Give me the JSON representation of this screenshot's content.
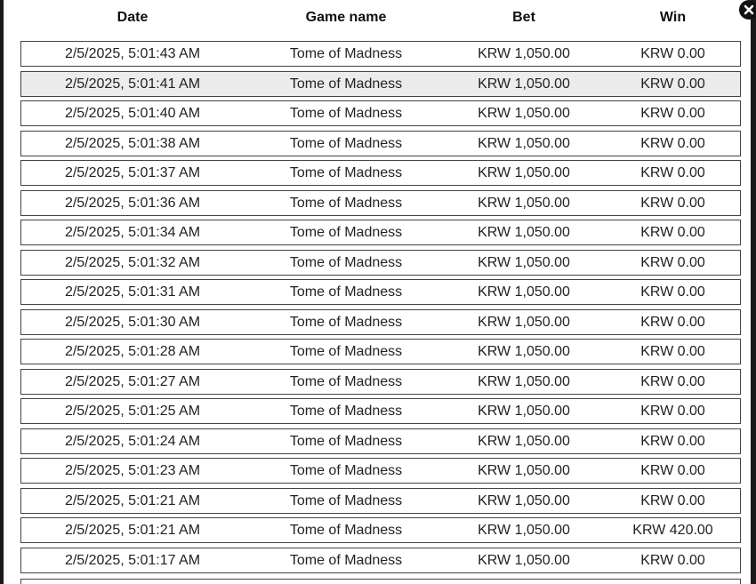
{
  "table": {
    "headers": {
      "date": "Date",
      "game": "Game name",
      "bet": "Bet",
      "win": "Win"
    },
    "rows": [
      {
        "date": "2/5/2025, 5:01:43 AM",
        "game": "Tome of Madness",
        "bet": "KRW 1,050.00",
        "win": "KRW 0.00"
      },
      {
        "date": "2/5/2025, 5:01:41 AM",
        "game": "Tome of Madness",
        "bet": "KRW 1,050.00",
        "win": "KRW 0.00"
      },
      {
        "date": "2/5/2025, 5:01:40 AM",
        "game": "Tome of Madness",
        "bet": "KRW 1,050.00",
        "win": "KRW 0.00"
      },
      {
        "date": "2/5/2025, 5:01:38 AM",
        "game": "Tome of Madness",
        "bet": "KRW 1,050.00",
        "win": "KRW 0.00"
      },
      {
        "date": "2/5/2025, 5:01:37 AM",
        "game": "Tome of Madness",
        "bet": "KRW 1,050.00",
        "win": "KRW 0.00"
      },
      {
        "date": "2/5/2025, 5:01:36 AM",
        "game": "Tome of Madness",
        "bet": "KRW 1,050.00",
        "win": "KRW 0.00"
      },
      {
        "date": "2/5/2025, 5:01:34 AM",
        "game": "Tome of Madness",
        "bet": "KRW 1,050.00",
        "win": "KRW 0.00"
      },
      {
        "date": "2/5/2025, 5:01:32 AM",
        "game": "Tome of Madness",
        "bet": "KRW 1,050.00",
        "win": "KRW 0.00"
      },
      {
        "date": "2/5/2025, 5:01:31 AM",
        "game": "Tome of Madness",
        "bet": "KRW 1,050.00",
        "win": "KRW 0.00"
      },
      {
        "date": "2/5/2025, 5:01:30 AM",
        "game": "Tome of Madness",
        "bet": "KRW 1,050.00",
        "win": "KRW 0.00"
      },
      {
        "date": "2/5/2025, 5:01:28 AM",
        "game": "Tome of Madness",
        "bet": "KRW 1,050.00",
        "win": "KRW 0.00"
      },
      {
        "date": "2/5/2025, 5:01:27 AM",
        "game": "Tome of Madness",
        "bet": "KRW 1,050.00",
        "win": "KRW 0.00"
      },
      {
        "date": "2/5/2025, 5:01:25 AM",
        "game": "Tome of Madness",
        "bet": "KRW 1,050.00",
        "win": "KRW 0.00"
      },
      {
        "date": "2/5/2025, 5:01:24 AM",
        "game": "Tome of Madness",
        "bet": "KRW 1,050.00",
        "win": "KRW 0.00"
      },
      {
        "date": "2/5/2025, 5:01:23 AM",
        "game": "Tome of Madness",
        "bet": "KRW 1,050.00",
        "win": "KRW 0.00"
      },
      {
        "date": "2/5/2025, 5:01:21 AM",
        "game": "Tome of Madness",
        "bet": "KRW 1,050.00",
        "win": "KRW 0.00"
      },
      {
        "date": "2/5/2025, 5:01:21 AM",
        "game": "Tome of Madness",
        "bet": "KRW 1,050.00",
        "win": "KRW 420.00"
      },
      {
        "date": "2/5/2025, 5:01:17 AM",
        "game": "Tome of Madness",
        "bet": "KRW 1,050.00",
        "win": "KRW 0.00"
      }
    ],
    "hovered_row": 1
  },
  "close_button": {
    "icon": "close-icon"
  },
  "colors": {
    "row_border": "#444444",
    "hover_bg": "#ececec"
  }
}
